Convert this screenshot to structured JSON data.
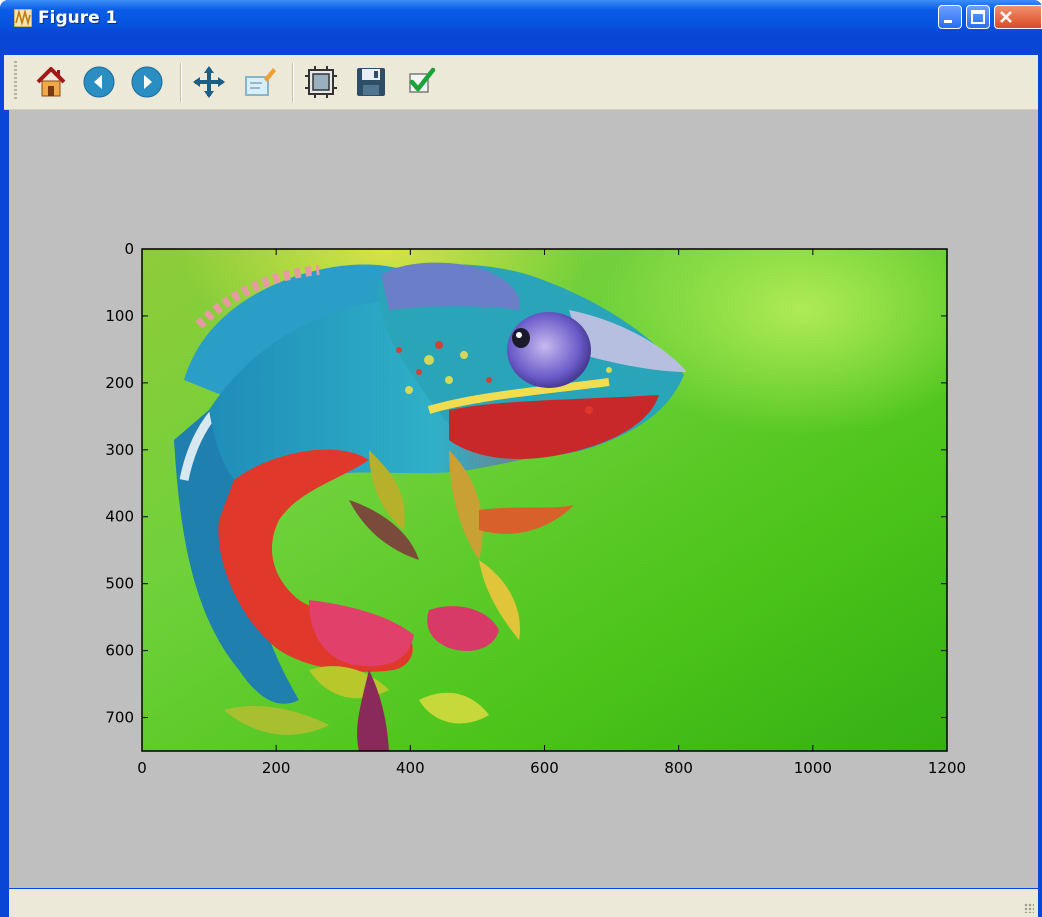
{
  "window": {
    "title": "Figure 1"
  },
  "toolbar": {
    "buttons": [
      {
        "name": "home",
        "icon": "home-icon"
      },
      {
        "name": "back",
        "icon": "back-arrow-icon"
      },
      {
        "name": "forward",
        "icon": "forward-arrow-icon"
      },
      {
        "name": "pan",
        "icon": "move-icon"
      },
      {
        "name": "zoom",
        "icon": "zoom-rect-icon"
      },
      {
        "name": "subplots",
        "icon": "subplots-icon"
      },
      {
        "name": "save",
        "icon": "save-icon"
      },
      {
        "name": "edit",
        "icon": "checkmark-icon"
      }
    ]
  },
  "plot": {
    "xticks": [
      "0",
      "200",
      "400",
      "600",
      "800",
      "1000",
      "1200"
    ],
    "yticks": [
      "0",
      "100",
      "200",
      "300",
      "400",
      "500",
      "600",
      "700"
    ],
    "xlim": [
      0,
      1200
    ],
    "ylim": [
      750,
      0
    ],
    "image_subject": "chameleon on plant against green background"
  },
  "colors": {
    "canvas": "#bfbfbf",
    "titlebar": "#0a5ce6",
    "toolbar": "#ece9d8",
    "background_green": "#5cc81e"
  }
}
